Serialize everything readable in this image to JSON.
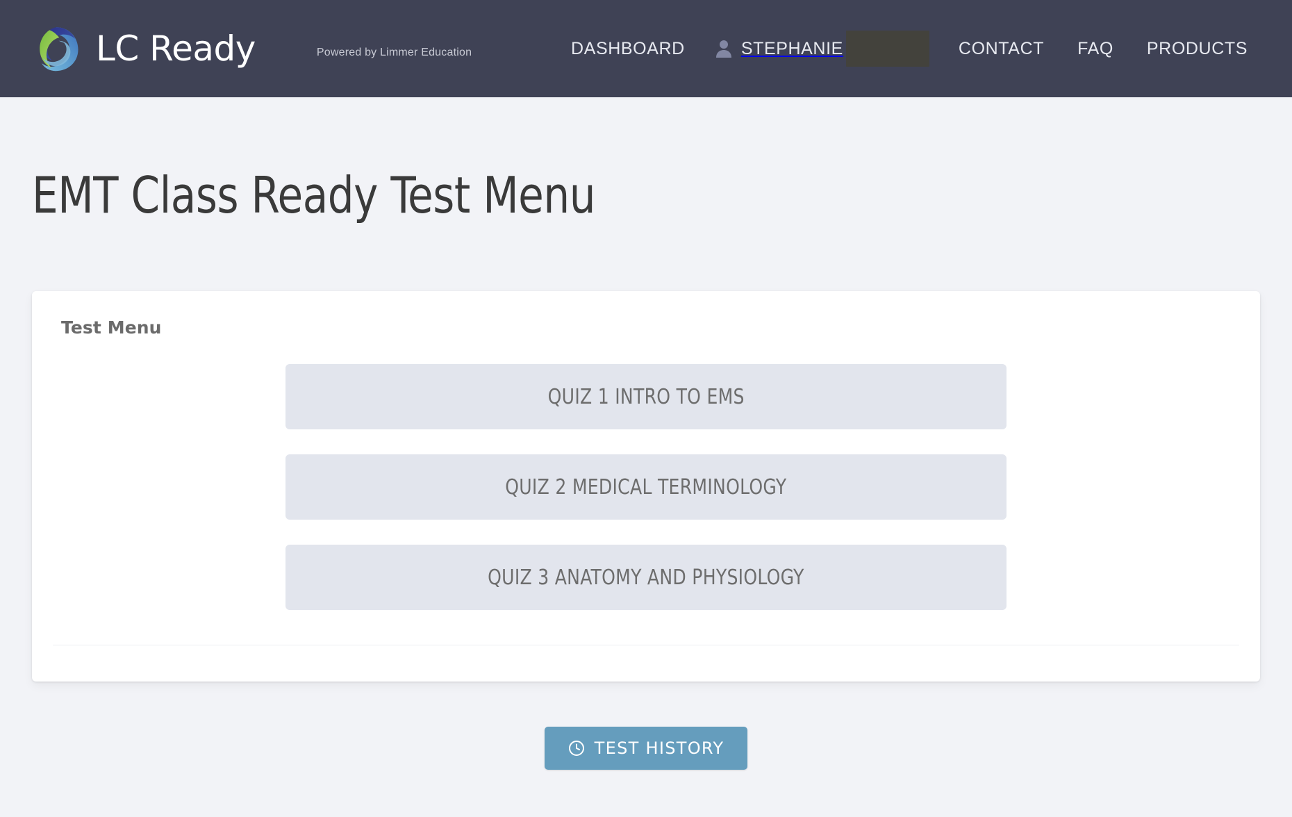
{
  "navbar": {
    "brand": {
      "name": "LC Ready",
      "tagline": "Powered by Limmer Education",
      "logo_icon": "lcready-swirl-logo",
      "colors": {
        "green": "#8dc63f",
        "light_blue": "#5b9bd5",
        "dark_blue": "#2e3192",
        "mid_blue": "#3b6cb5"
      }
    },
    "background_color": "#3f4255",
    "links": [
      {
        "label": "DASHBOARD",
        "name": "dashboard"
      },
      {
        "label": "CONTACT",
        "name": "contact"
      },
      {
        "label": "FAQ",
        "name": "faq"
      },
      {
        "label": "PRODUCTS",
        "name": "products"
      }
    ],
    "user": {
      "icon": "user-icon",
      "name": "STEPHANIE",
      "redacted": true
    }
  },
  "page": {
    "title": "EMT Class Ready Test Menu"
  },
  "card": {
    "heading": "Test Menu",
    "quizzes": [
      {
        "label": "QUIZ 1 INTRO TO EMS"
      },
      {
        "label": "QUIZ 2 MEDICAL TERMINOLOGY"
      },
      {
        "label": "QUIZ 3 ANATOMY AND PHYSIOLOGY"
      }
    ]
  },
  "footer": {
    "history_button": {
      "label": "TEST HISTORY",
      "icon": "clock-icon",
      "color": "#659dbd"
    }
  }
}
